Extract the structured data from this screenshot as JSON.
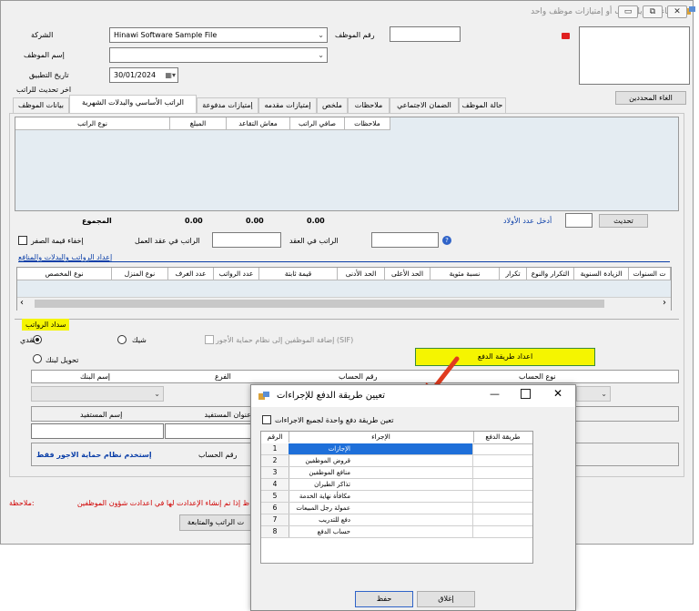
{
  "window": {
    "title": "إنشاء / تعديل راتب أو إمتيازات موظف واحد",
    "minimize_glyph": "▭",
    "maximize_glyph": "⧉",
    "close_glyph": "✕"
  },
  "form": {
    "company_label": "الشركة",
    "company_value": "Hinawi Software Sample File",
    "employee_number_label": "رقم الموظف",
    "employee_name_label": "إسم الموظف",
    "apply_date_label": "تاريخ التطبيق",
    "apply_date_value": "30/01/2024",
    "last_salary_update_label": "اخر تحديث للراتب",
    "cancel_selection_button": "الغاء المحددين"
  },
  "tabs": [
    {
      "label": "بيانات الموظف"
    },
    {
      "label": "الراتب الأساسي والبدلات الشهرية"
    },
    {
      "label": "إمتيازات مدفوعة"
    },
    {
      "label": "إمتيازات مقدمه"
    },
    {
      "label": "ملخص"
    },
    {
      "label": "ملاحظات"
    },
    {
      "label": "الضمان الاجتماعي"
    },
    {
      "label": "حالة الموظف"
    }
  ],
  "salary_grid": {
    "columns": [
      "نوع الراتب",
      "المبلغ",
      "معاش التقاعد",
      "صافي الراتب",
      "ملاحظات"
    ]
  },
  "totals": {
    "total_label": "المجموع",
    "total_amount": "0.00",
    "total_pension": "0.00",
    "total_net": "0.00",
    "children_label": "أدخل عدد الأولاد",
    "update_button": "تحديث",
    "hide_zero_label": "إخفاء قيمة الصفر",
    "contract_salary_label": "الراتب في عقد العمل",
    "in_contract_label": "الراتب في العقد",
    "help_glyph": "?"
  },
  "benefits": {
    "setup_link": "إعداد الرواتب والبدلات والمنافع",
    "columns": [
      "نوع المخصص",
      "نوع المنزل",
      "عدد الغرف",
      "عدد الرواتب",
      "قيمة ثابتة",
      "الحد الأدنى",
      "الحد الأعلى",
      "نسبة مئوية",
      "تكرار",
      "التكرار والنوع",
      "الزيادة السنوية",
      "ت السنوات"
    ],
    "scroll_left": "‹",
    "scroll_right": "›"
  },
  "payment": {
    "section_label": "سداد الرواتب",
    "cash_label": "نقدي",
    "cheque_label": "شيك",
    "bank_transfer_label": "تحويل لبنك",
    "wps_add_label": "إضافة الموظفين إلى نظام حماية الأجور (SIF)",
    "set_payment_button": "اعداد طريقة الدفع",
    "bank_columns": [
      "إسم البنك",
      "الفرع",
      "رقم الحساب",
      "نوع الحساب"
    ],
    "beneficiary_columns": [
      "إسم المستفيد",
      "عنوان المستفيد"
    ],
    "account_number_label": "رقم الحساب",
    "wps_only_label": "إستخدم نظام حماية الاجور فقط"
  },
  "footer": {
    "note_label": "ملاحظة:",
    "note_text": "ظ إذا تم إنشاء الإعدادت لها في اعدادت شؤون الموظفين",
    "save_follow_button": "ت الراتب والمتابعة"
  },
  "dialog": {
    "title": "تعيين طريقة الدفع للإجراءات",
    "single_method_label": "تعين طريقة دفع واحدة لجميع الاجراءات",
    "columns": {
      "number": "الرقم",
      "procedure": "الإجراء",
      "payment_method": "طريقة الدفع"
    },
    "rows": [
      {
        "number": "1",
        "procedure": "الإجازات"
      },
      {
        "number": "2",
        "procedure": "قروض الموظفين"
      },
      {
        "number": "3",
        "procedure": "منافع الموظفين"
      },
      {
        "number": "4",
        "procedure": "تذاكر الطيران"
      },
      {
        "number": "5",
        "procedure": "مكافأة نهاية الخدمة"
      },
      {
        "number": "6",
        "procedure": "عمولة رجل المبيعات"
      },
      {
        "number": "7",
        "procedure": "دفع للتدريب"
      },
      {
        "number": "8",
        "procedure": "حساب الدفع"
      }
    ],
    "save_button": "حفظ",
    "close_button": "إغلاق"
  },
  "colors": {
    "highlight_yellow": "#f5f500",
    "link_blue": "#0b3fa8",
    "note_red": "#d00000",
    "arrow_red": "#e03b1f",
    "selection_blue": "#1e6fd9"
  }
}
